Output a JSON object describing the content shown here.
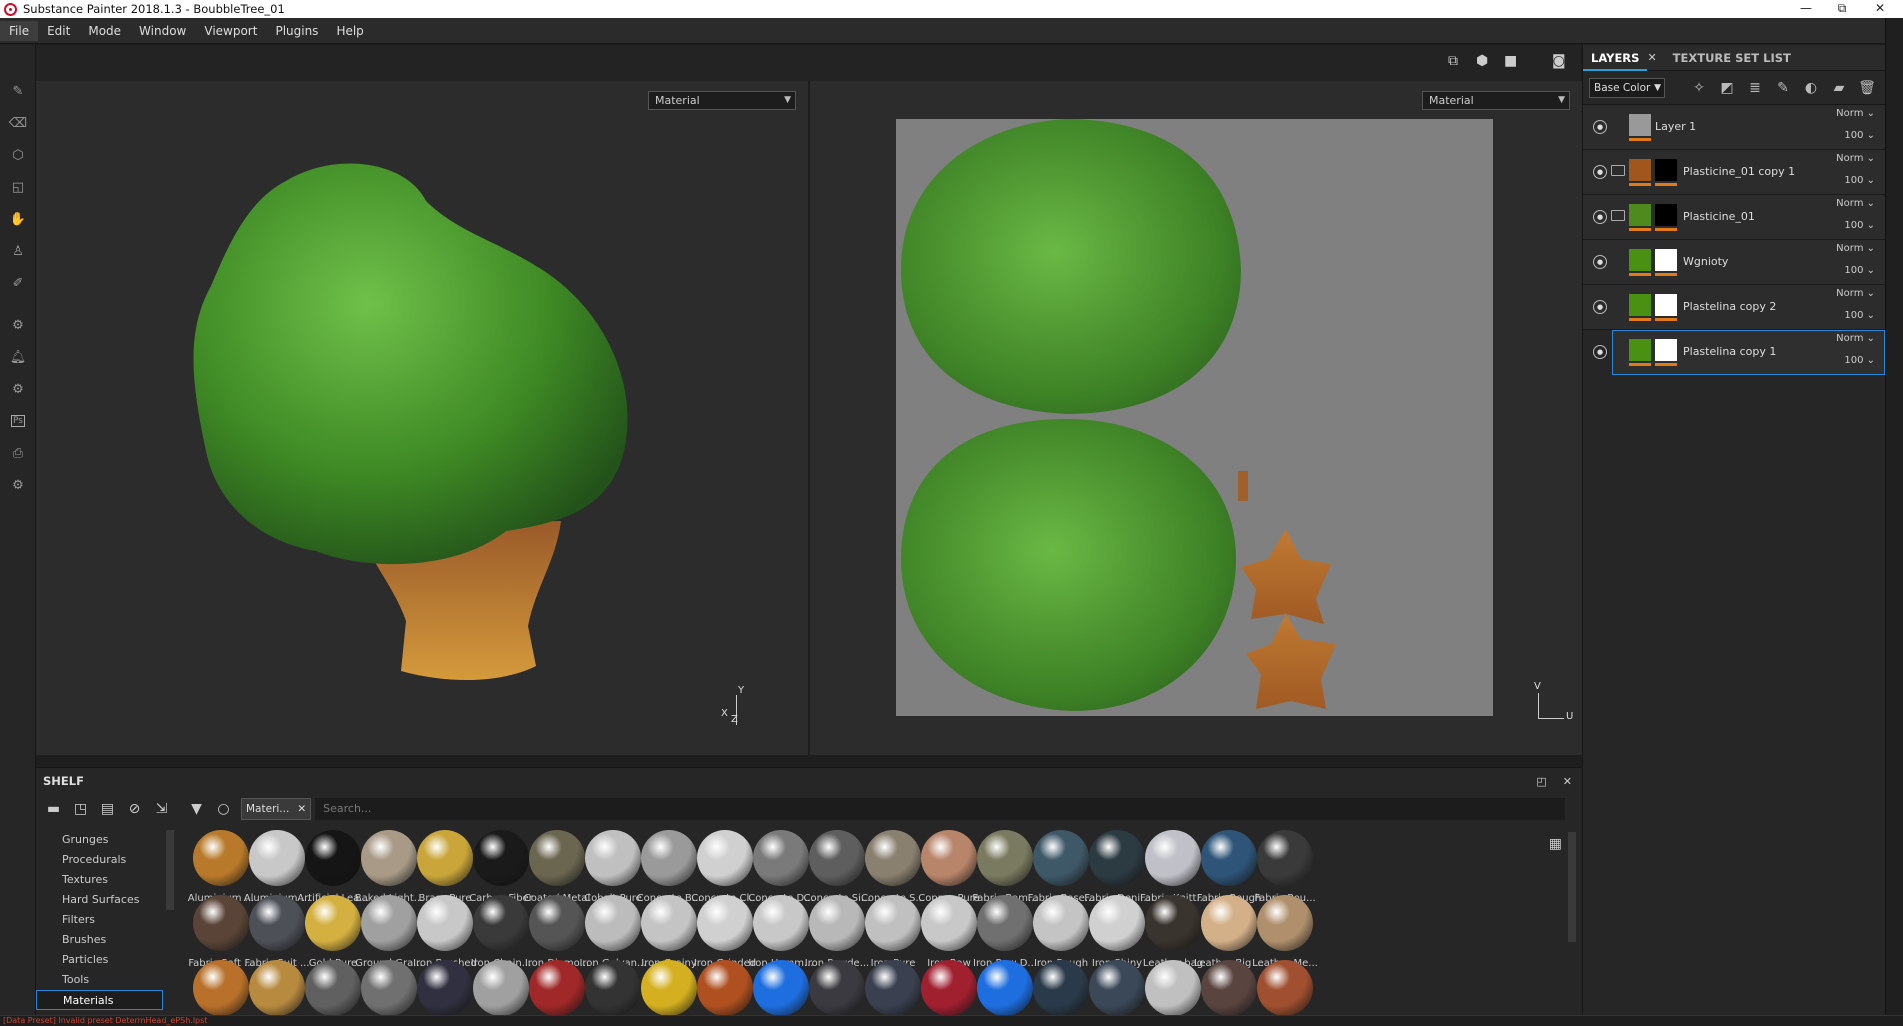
{
  "window": {
    "title": "Substance Painter 2018.1.3 - BoubbleTree_01",
    "controls": [
      "—",
      "⧉",
      "✕"
    ]
  },
  "menu": [
    "File",
    "Edit",
    "Mode",
    "Window",
    "Viewport",
    "Plugins",
    "Help"
  ],
  "viewport_toolbar": [
    "split-view-icon",
    "cube-icon",
    "camera-icon",
    "screenshot-icon"
  ],
  "left_tools": [
    "paint-icon",
    "eraser-icon",
    "projection-icon",
    "polygon-fill-icon",
    "smudge-icon",
    "clone-icon",
    "color-picker-icon",
    "settings-icon",
    "bell-icon",
    "settings-icon",
    "Ps",
    "export-icon",
    "gear-icon"
  ],
  "viewport3d": {
    "mode": "Material",
    "axis_x": "X",
    "axis_y": "Y",
    "axis_z": "Z"
  },
  "viewport2d": {
    "mode": "Material",
    "axis_v": "V",
    "axis_u": "U"
  },
  "layers_panel": {
    "tab_layers": "LAYERS",
    "tab_texture": "TEXTURE SET LIST",
    "channel": "Base Color",
    "tools": [
      "effects-icon",
      "mask-icon",
      "fill-layer-icon",
      "paint-layer-icon",
      "folder-icon",
      "delete-icon"
    ],
    "layers": [
      {
        "name": "Layer 1",
        "blend": "Norm",
        "opacity": "100",
        "thumb": "#999999",
        "mask": "",
        "folder": false
      },
      {
        "name": "Plasticine_01 copy 1",
        "blend": "Norm",
        "opacity": "100",
        "thumb": "#a0561c",
        "mask": "#000000",
        "folder": true
      },
      {
        "name": "Plasticine_01",
        "blend": "Norm",
        "opacity": "100",
        "thumb": "#4f8a1e",
        "mask": "#000000",
        "folder": true
      },
      {
        "name": "Wgnioty",
        "blend": "Norm",
        "opacity": "100",
        "thumb": "#4a9012",
        "mask": "#ffffff",
        "folder": false
      },
      {
        "name": "Plastelina copy 2",
        "blend": "Norm",
        "opacity": "100",
        "thumb": "#4a9012",
        "mask": "#ffffff",
        "folder": false
      },
      {
        "name": "Plastelina copy 1",
        "blend": "Norm",
        "opacity": "100",
        "thumb": "#4a9012",
        "mask": "#ffffff",
        "folder": false,
        "selected": true
      }
    ]
  },
  "shelf": {
    "title": "SHELF",
    "filter_chip": "Materi...",
    "search_placeholder": "Search...",
    "categories": [
      "Grunges",
      "Procedurals",
      "Textures",
      "Hard Surfaces",
      "Filters",
      "Brushes",
      "Particles",
      "Tools",
      "Materials"
    ],
    "selected_category": "Materials",
    "materials_row1": [
      "Aluminium ...",
      "Aluminium ...",
      "Artificial Lea...",
      "Baked Light...",
      "Brass Pure",
      "Carbon Fiber",
      "Coated Metal",
      "Cobalt Pure",
      "Concrete B...",
      "Concrete Cl...",
      "Concrete D...",
      "Concrete Si...",
      "Concrete S...",
      "Copper Pure",
      "Fabric Bam...",
      "Fabric Base...",
      "Fabric Deni...",
      "Fabric Knitt...",
      "Fabric Rough",
      "Fabric Rou..."
    ],
    "materials_row2": [
      "Fabric Soft ...",
      "Fabric Suit ...",
      "Gold Pure",
      "Ground Gra...",
      "Iron Brushed",
      "Iron Chain...",
      "Iron Diamo...",
      "Iron Galvan...",
      "Iron Grainy",
      "Iron Grinded",
      "Iron Hamm...",
      "Iron Powde...",
      "Iron Pure",
      "Iron Raw",
      "Iron Raw D...",
      "Iron Rough",
      "Iron Shiny",
      "Leather bag",
      "Leather Big ...",
      "Leather Me..."
    ],
    "colors_row1": [
      "#b87a2a",
      "#c8c8c8",
      "#151515",
      "#a89a86",
      "#c9a53a",
      "#1a1a1a",
      "#6a6650",
      "#c0c0c0",
      "#9a9a9a",
      "#d0d0d0",
      "#7a7a7a",
      "#5e5e5e",
      "#8a8070",
      "#b8846a",
      "#7a7a60",
      "#3e5868",
      "#2c3a42",
      "#c0c0c8",
      "#2e5478",
      "#3a3a3a"
    ],
    "colors_row2": [
      "#5a4438",
      "#4e5058",
      "#d4b040",
      "#a0a0a0",
      "#c8c8c8",
      "#3a3a3a",
      "#555555",
      "#bcbcbc",
      "#c4c4c4",
      "#d0d0d0",
      "#c8c8c8",
      "#b8b8b8",
      "#c0c0c0",
      "#c8c8c8",
      "#707070",
      "#c4c4c4",
      "#d0d0d0",
      "#3a342e",
      "#d4b088",
      "#b0906c"
    ],
    "colors_row3": [
      "#b8702a",
      "#b88a40",
      "#606060",
      "#707070",
      "#303040",
      "#a0a0a0",
      "#a02828",
      "#333333",
      "#d4b020",
      "#b05020",
      "#1e6ee0",
      "#3a3a40",
      "#3a4050",
      "#a02030",
      "#1e6ee0",
      "#2a3a4a",
      "#3a4858",
      "#c0c0c0",
      "#5a4440",
      "#a05030"
    ]
  },
  "status": "[Data Preset] Invalid preset DetermHead_ePSh.lpst"
}
